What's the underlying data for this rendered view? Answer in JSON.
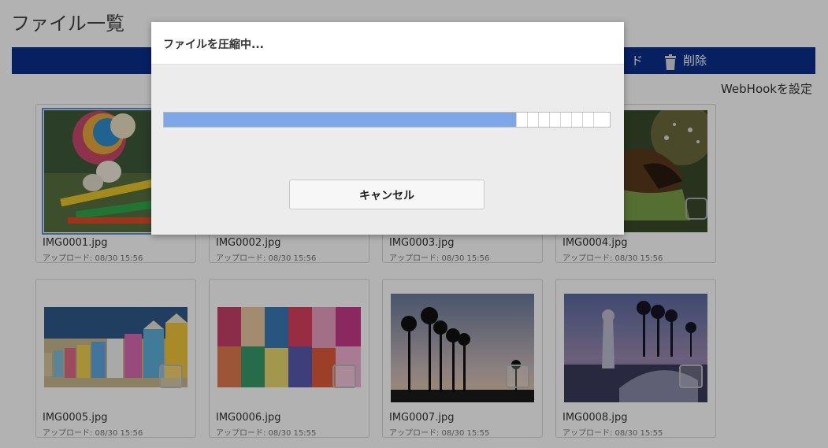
{
  "page": {
    "title": "ファイル一覧"
  },
  "toolbar": {
    "download_label": "ド",
    "delete_label": "削除"
  },
  "webhook": {
    "label": "WebHookを設定"
  },
  "files": [
    {
      "name": "IMG0001.jpg",
      "uploaded": "アップロード: 08/30 15:56"
    },
    {
      "name": "IMG0002.jpg",
      "uploaded": "アップロード: 08/30 15:56"
    },
    {
      "name": "IMG0003.jpg",
      "uploaded": "アップロード: 08/30 15:56"
    },
    {
      "name": "IMG0004.jpg",
      "uploaded": "アップロード: 08/30 15:56"
    },
    {
      "name": "IMG0005.jpg",
      "uploaded": "アップロード: 08/30 15:56"
    },
    {
      "name": "IMG0006.jpg",
      "uploaded": "アップロード: 08/30 15:55"
    },
    {
      "name": "IMG0007.jpg",
      "uploaded": "アップロード: 08/30 15:55"
    },
    {
      "name": "IMG0008.jpg",
      "uploaded": "アップロード: 08/30 15:55"
    }
  ],
  "dialog": {
    "title": "ファイルを圧縮中...",
    "progress": 0.79,
    "cancel_label": "キャンセル"
  },
  "colors": {
    "toolbar": "#0a2f8c",
    "progress": "#7ea7ea"
  }
}
